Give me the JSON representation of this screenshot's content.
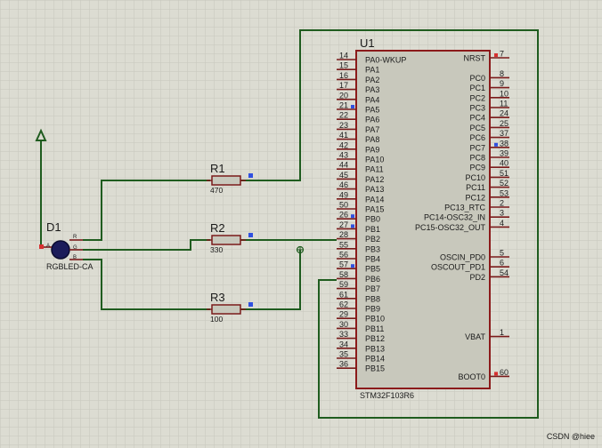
{
  "schematic": {
    "chip": {
      "ref": "U1",
      "part": "STM32F103R6",
      "left_pins": [
        {
          "num": "14",
          "name": "PA0-WKUP"
        },
        {
          "num": "15",
          "name": "PA1"
        },
        {
          "num": "16",
          "name": "PA2"
        },
        {
          "num": "17",
          "name": "PA3"
        },
        {
          "num": "20",
          "name": "PA4"
        },
        {
          "num": "21",
          "name": "PA5"
        },
        {
          "num": "22",
          "name": "PA6"
        },
        {
          "num": "23",
          "name": "PA7"
        },
        {
          "num": "41",
          "name": "PA8"
        },
        {
          "num": "42",
          "name": "PA9"
        },
        {
          "num": "43",
          "name": "PA10"
        },
        {
          "num": "44",
          "name": "PA11"
        },
        {
          "num": "45",
          "name": "PA12"
        },
        {
          "num": "46",
          "name": "PA13"
        },
        {
          "num": "49",
          "name": "PA14"
        },
        {
          "num": "50",
          "name": "PA15"
        },
        {
          "num": "26",
          "name": "PB0"
        },
        {
          "num": "27",
          "name": "PB1"
        },
        {
          "num": "28",
          "name": "PB2"
        },
        {
          "num": "55",
          "name": "PB3"
        },
        {
          "num": "56",
          "name": "PB4"
        },
        {
          "num": "57",
          "name": "PB5"
        },
        {
          "num": "58",
          "name": "PB6"
        },
        {
          "num": "59",
          "name": "PB7"
        },
        {
          "num": "61",
          "name": "PB8"
        },
        {
          "num": "62",
          "name": "PB9"
        },
        {
          "num": "29",
          "name": "PB10"
        },
        {
          "num": "30",
          "name": "PB11"
        },
        {
          "num": "33",
          "name": "PB12"
        },
        {
          "num": "34",
          "name": "PB13"
        },
        {
          "num": "35",
          "name": "PB14"
        },
        {
          "num": "36",
          "name": "PB15"
        }
      ],
      "right_pins": [
        {
          "num": "7",
          "name": "NRST"
        },
        {
          "num": "8",
          "name": "PC0"
        },
        {
          "num": "9",
          "name": "PC1"
        },
        {
          "num": "10",
          "name": "PC2"
        },
        {
          "num": "11",
          "name": "PC3"
        },
        {
          "num": "24",
          "name": "PC4"
        },
        {
          "num": "25",
          "name": "PC5"
        },
        {
          "num": "37",
          "name": "PC6"
        },
        {
          "num": "38",
          "name": "PC7"
        },
        {
          "num": "39",
          "name": "PC8"
        },
        {
          "num": "40",
          "name": "PC9"
        },
        {
          "num": "51",
          "name": "PC10"
        },
        {
          "num": "52",
          "name": "PC11"
        },
        {
          "num": "53",
          "name": "PC12"
        },
        {
          "num": "2",
          "name": "PC13_RTC"
        },
        {
          "num": "3",
          "name": "PC14-OSC32_IN"
        },
        {
          "num": "4",
          "name": "PC15-OSC32_OUT"
        },
        {
          "num": "5",
          "name": "OSCIN_PD0"
        },
        {
          "num": "6",
          "name": "OSCOUT_PD1"
        },
        {
          "num": "54",
          "name": "PD2"
        },
        {
          "num": "1",
          "name": "VBAT"
        },
        {
          "num": "60",
          "name": "BOOT0"
        }
      ]
    },
    "resistors": [
      {
        "ref": "R1",
        "value": "470"
      },
      {
        "ref": "R2",
        "value": "330"
      },
      {
        "ref": "R3",
        "value": "100"
      }
    ],
    "led": {
      "ref": "D1",
      "part": "RGBLED-CA",
      "pin_labels": [
        "A",
        "R",
        "G",
        "B"
      ]
    },
    "watermark": "CSDN @hiee",
    "colors": {
      "background": "#dcdcd2",
      "grid": "#c6c6bc",
      "chip_fill": "#c8c8bc",
      "chip_border": "#8b1a1a",
      "wire": "#1f5c1f",
      "pin_lead": "#7a1a1a",
      "pin_marker_red": "#d63030",
      "pin_marker_blue": "#3050e0",
      "led_body": "#1b1b5a",
      "resistor_fill": "#c8c8bc"
    }
  }
}
